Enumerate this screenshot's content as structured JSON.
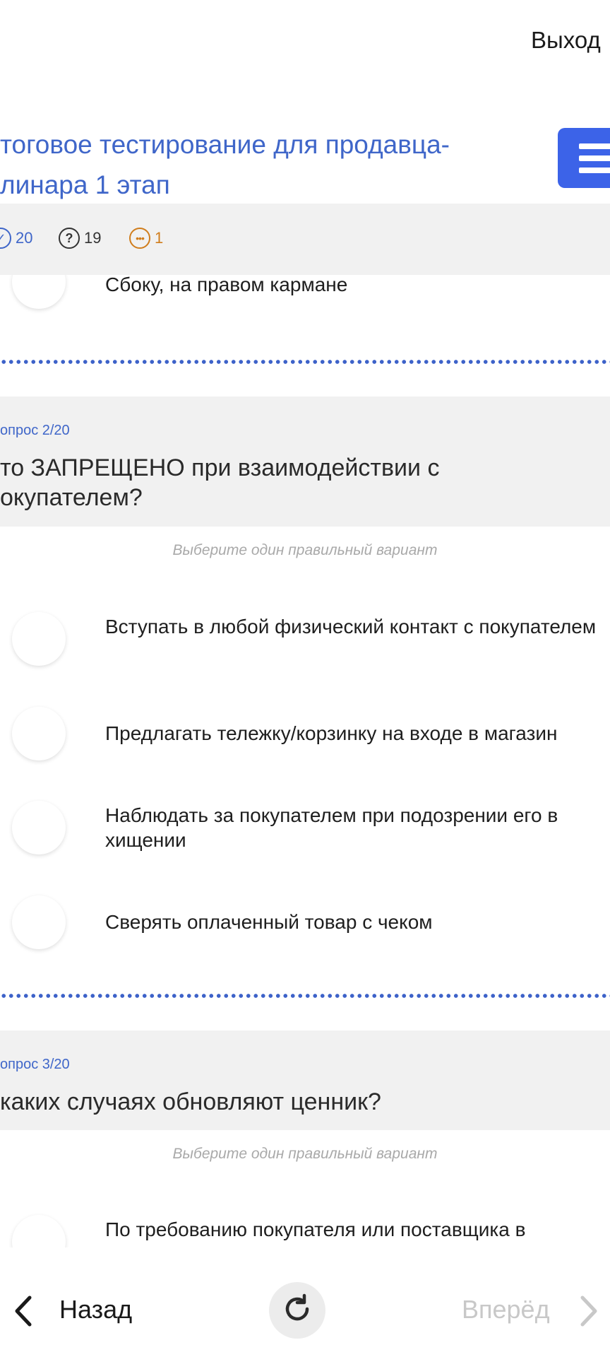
{
  "header": {
    "exit_label": "Выход",
    "title": "тоговое тестирование для продавца-\nлинара 1 этап"
  },
  "stats": {
    "answered": "20",
    "unanswered": "19",
    "in_progress": "1",
    "colors": {
      "answered": "#3f66c9",
      "unanswered": "#333333",
      "in_progress": "#d07d1c"
    }
  },
  "partial_answer": {
    "text": "Сбоку, на правом кармане"
  },
  "questions": [
    {
      "number": "опрос 2/20",
      "text": "то ЗАПРЕЩЕНО при взаимодействии с\nокупателем?",
      "hint": "Выберите один правильный вариант",
      "answers": [
        "Вступать в любой физический контакт с покупателем",
        "Предлагать тележку/корзинку на входе в магазин",
        "Наблюдать за покупателем при подозрении его в хищении",
        "Сверять оплаченный товар с чеком"
      ]
    },
    {
      "number": "опрос 3/20",
      "text": " каких случаях обновляют ценник?",
      "hint": "Выберите один правильный вариант",
      "answers": [
        "По требованию покупателя или поставщика в"
      ]
    }
  ],
  "footer": {
    "back_label": "Назад",
    "next_label": "Вперёд"
  },
  "icons": {
    "menu": "menu-icon",
    "back": "chevron-left-icon",
    "next": "chevron-right-icon",
    "refresh": "refresh-icon"
  },
  "accent_color": "#3c63e8"
}
